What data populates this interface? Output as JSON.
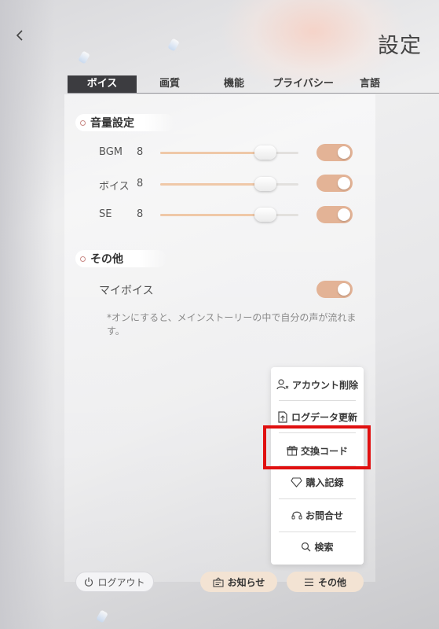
{
  "header": {
    "title": "設定"
  },
  "tabs": [
    {
      "label": "ボイス",
      "active": true
    },
    {
      "label": "画質",
      "active": false
    },
    {
      "label": "機能",
      "active": false
    },
    {
      "label": "プライバシー",
      "active": false
    },
    {
      "label": "言語",
      "active": false
    }
  ],
  "volume": {
    "title": "音量設定",
    "rows": [
      {
        "label": "BGM",
        "value": "8",
        "level": 0.8,
        "enabled": true
      },
      {
        "label": "ボイス",
        "value": "8",
        "level": 0.8,
        "enabled": true
      },
      {
        "label": "SE",
        "value": "8",
        "level": 0.8,
        "enabled": true
      }
    ]
  },
  "other": {
    "title": "その他",
    "my_voice_label": "マイボイス",
    "my_voice_enabled": true,
    "note": "*オンにすると、メインストーリーの中で自分の声が流れます。"
  },
  "menu": {
    "items": [
      {
        "label": "アカウント削除",
        "icon": "user-remove-icon"
      },
      {
        "label": "ログデータ更新",
        "icon": "file-upload-icon"
      },
      {
        "label": "交換コード",
        "icon": "gift-icon"
      },
      {
        "label": "購入記録",
        "icon": "diamond-icon"
      },
      {
        "label": "お問合せ",
        "icon": "headset-icon"
      },
      {
        "label": "検索",
        "icon": "search-icon"
      }
    ],
    "highlighted": "交換コード"
  },
  "bottom": {
    "logout": "ログアウト",
    "notice": "お知らせ",
    "other": "その他"
  },
  "colors": {
    "accent": "#e3b396",
    "slider_fill": "#efc8a8",
    "tab_active_bg": "#3c3c40",
    "highlight": "#e01010"
  }
}
